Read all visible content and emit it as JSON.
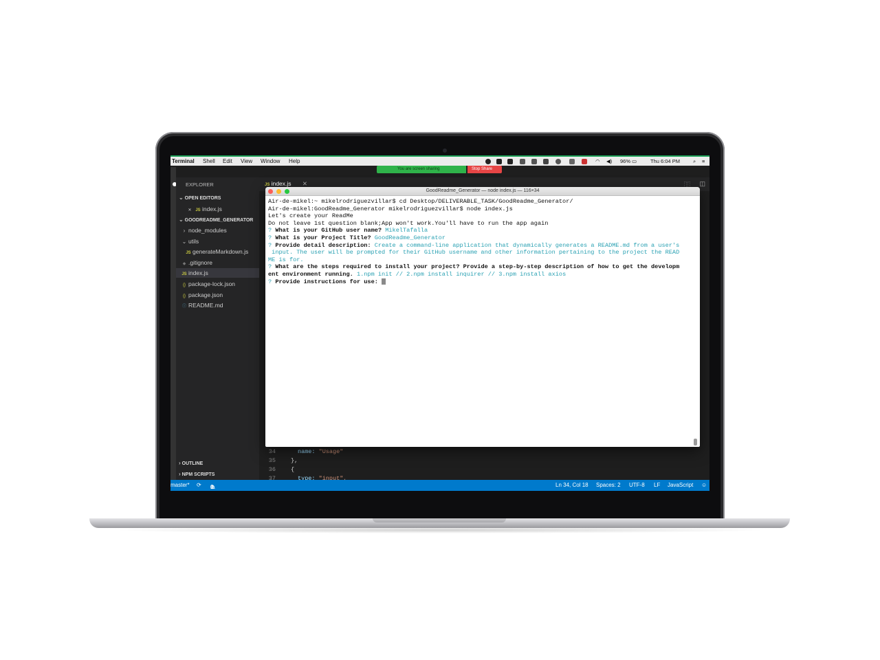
{
  "menubar": {
    "app": "Terminal",
    "items": [
      "Shell",
      "Edit",
      "View",
      "Window",
      "Help"
    ],
    "battery": "96%",
    "clock": "Thu 6:04 PM"
  },
  "screen_share": {
    "message": "You are screen sharing",
    "stop": "Stop Share"
  },
  "explorer": {
    "title": "EXPLORER",
    "open_editors": "OPEN EDITORS",
    "open_file": "index.js",
    "project": "GOODREADME_GENERATOR",
    "files": [
      "node_modules",
      "utils",
      "generateMarkdown.js",
      ".gitignore",
      "index.js",
      "package-lock.json",
      "package.json",
      "README.md"
    ],
    "outline": "OUTLINE",
    "npm_scripts": "NPM SCRIPTS"
  },
  "editor": {
    "tab": "index.js",
    "lines": [
      {
        "num": "34",
        "key": "name: ",
        "value": "\"Usage\""
      },
      {
        "num": "35",
        "text": "},"
      },
      {
        "num": "36",
        "text": "{"
      },
      {
        "num": "37",
        "key": "type: ",
        "value": "\"input\","
      }
    ]
  },
  "statusbar": {
    "branch": "master*",
    "problems": "0",
    "warnings": "0",
    "position": "Ln 34, Col 18",
    "spaces": "Spaces: 2",
    "encoding": "UTF-8",
    "eol": "LF",
    "language": "JavaScript"
  },
  "terminal": {
    "title": "GoodReadme_Generator — node index.js — 116×34",
    "line1": "Air-de-mikel:~ mikelrodriguezvillar$ cd Desktop/DELIVERABLE_TASK/GoodReadme_Generator/",
    "line2": "Air-de-mikel:GoodReadme_Generator mikelrodriguezvillar$ node index.js",
    "line3": "Let's create your ReadMe",
    "line4": "Do not leave 1st question blank;App won't work.You'll have to run the app again",
    "q1": "What is your GitHub user name?",
    "a1": "MikelTafalla",
    "q2": "What is your Project Title?",
    "a2": "GoodReadme_Generator",
    "q3": "Provide detail description:",
    "a3_1": "Create a command-line application that dynamically generates a README.md from a user's",
    "a3_2": " input. The user will be prompted for their GitHub username and other information pertaining to the project the READ",
    "a3_3": "ME is for.",
    "q4_1": "What are the steps required to install your project? Provide a step-by-step description of how to get the developm",
    "q4_2": "ent environment running.",
    "a4": "1.npm init // 2.npm install inquirer // 3.npm install axios",
    "q5": "Provide instructions for use:"
  }
}
